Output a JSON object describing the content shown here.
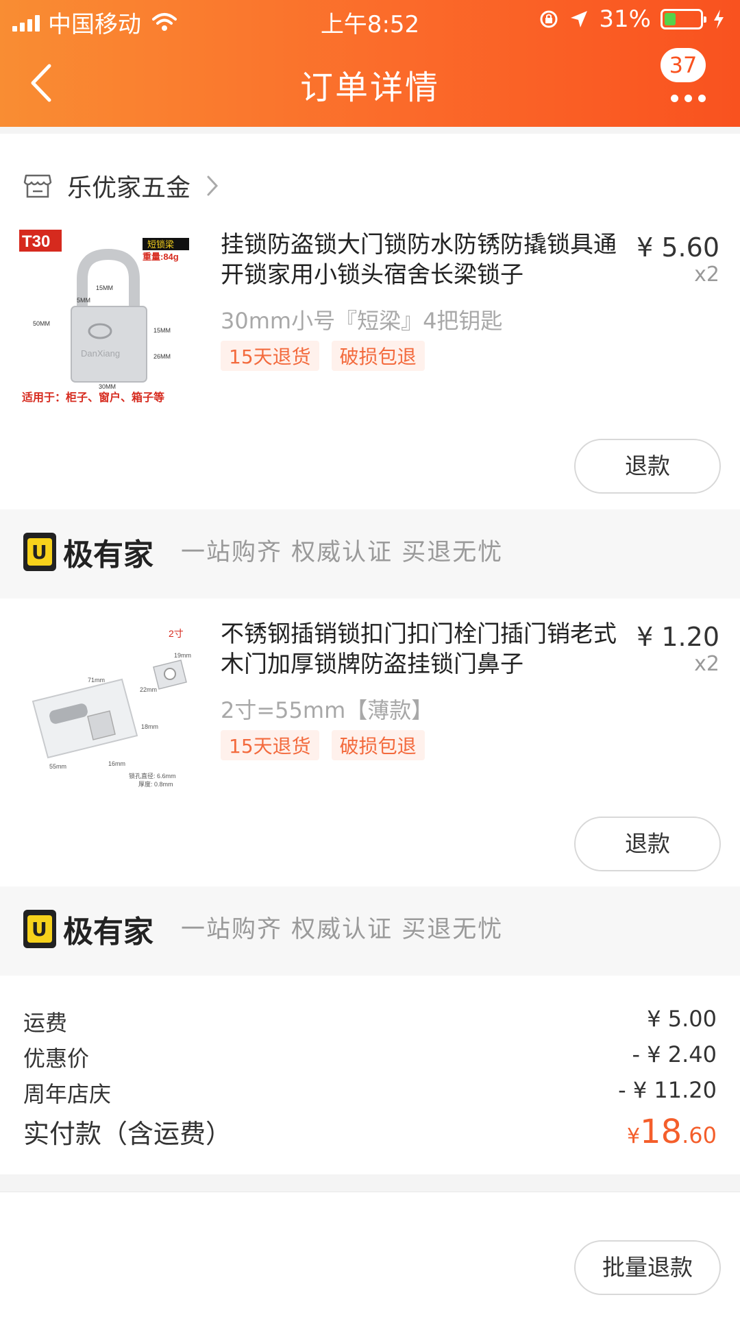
{
  "status_bar": {
    "carrier": "中国移动",
    "time": "上午8:52",
    "battery_percent": "31%",
    "battery_level": 0.31
  },
  "nav": {
    "title": "订单详情",
    "message_count": "37"
  },
  "shop": {
    "name": "乐优家五金"
  },
  "products": [
    {
      "title": "挂锁防盗锁大门锁防水防锈防撬锁具通开锁家用小锁头宿舍长梁锁子",
      "price": "¥ 5.60",
      "qty": "x2",
      "spec": "30mm小号『短梁』4把钥匙",
      "tags": [
        "15天退货",
        "破损包退"
      ],
      "refund_label": "退款",
      "image": {
        "badge": "T30",
        "corner": "短锁梁",
        "weight": "重量:84g",
        "dims": [
          "15MM",
          "5MM",
          "50MM",
          "15MM",
          "26MM",
          "30MM"
        ],
        "brand": "DanXiang",
        "caption": "适用于：柜子、窗户、箱子等"
      }
    },
    {
      "title": "不锈钢插销锁扣门扣门栓门插门销老式木门加厚锁牌防盗挂锁门鼻子",
      "price": "¥ 1.20",
      "qty": "x2",
      "spec": "2寸=55mm【薄款】",
      "tags": [
        "15天退货",
        "破损包退"
      ],
      "refund_label": "退款",
      "image": {
        "corner": "2寸",
        "dims": [
          "71mm",
          "22mm",
          "19mm",
          "55mm",
          "16mm",
          "18mm"
        ],
        "note1": "锁孔直径: 6.6mm",
        "note2": "厚度: 0.8mm"
      }
    }
  ],
  "banner": {
    "brand": "极有家",
    "slogan": "一站购齐 权威认证 买退无忧"
  },
  "totals": {
    "shipping_label": "运费",
    "shipping_value": "¥ 5.00",
    "discount_label": "优惠价",
    "discount_value": "- ¥ 2.40",
    "anniversary_label": "周年店庆",
    "anniversary_value": "- ¥ 11.20",
    "paid_label": "实付款（含运费）",
    "paid_symbol": "¥",
    "paid_integer": "18",
    "paid_decimal": ".60"
  },
  "footer": {
    "batch_refund_label": "批量退款"
  },
  "colors": {
    "header_start": "#f98d33",
    "header_end": "#f9521f",
    "accent": "#f45e2b",
    "tag_bg": "#fff1ec"
  }
}
